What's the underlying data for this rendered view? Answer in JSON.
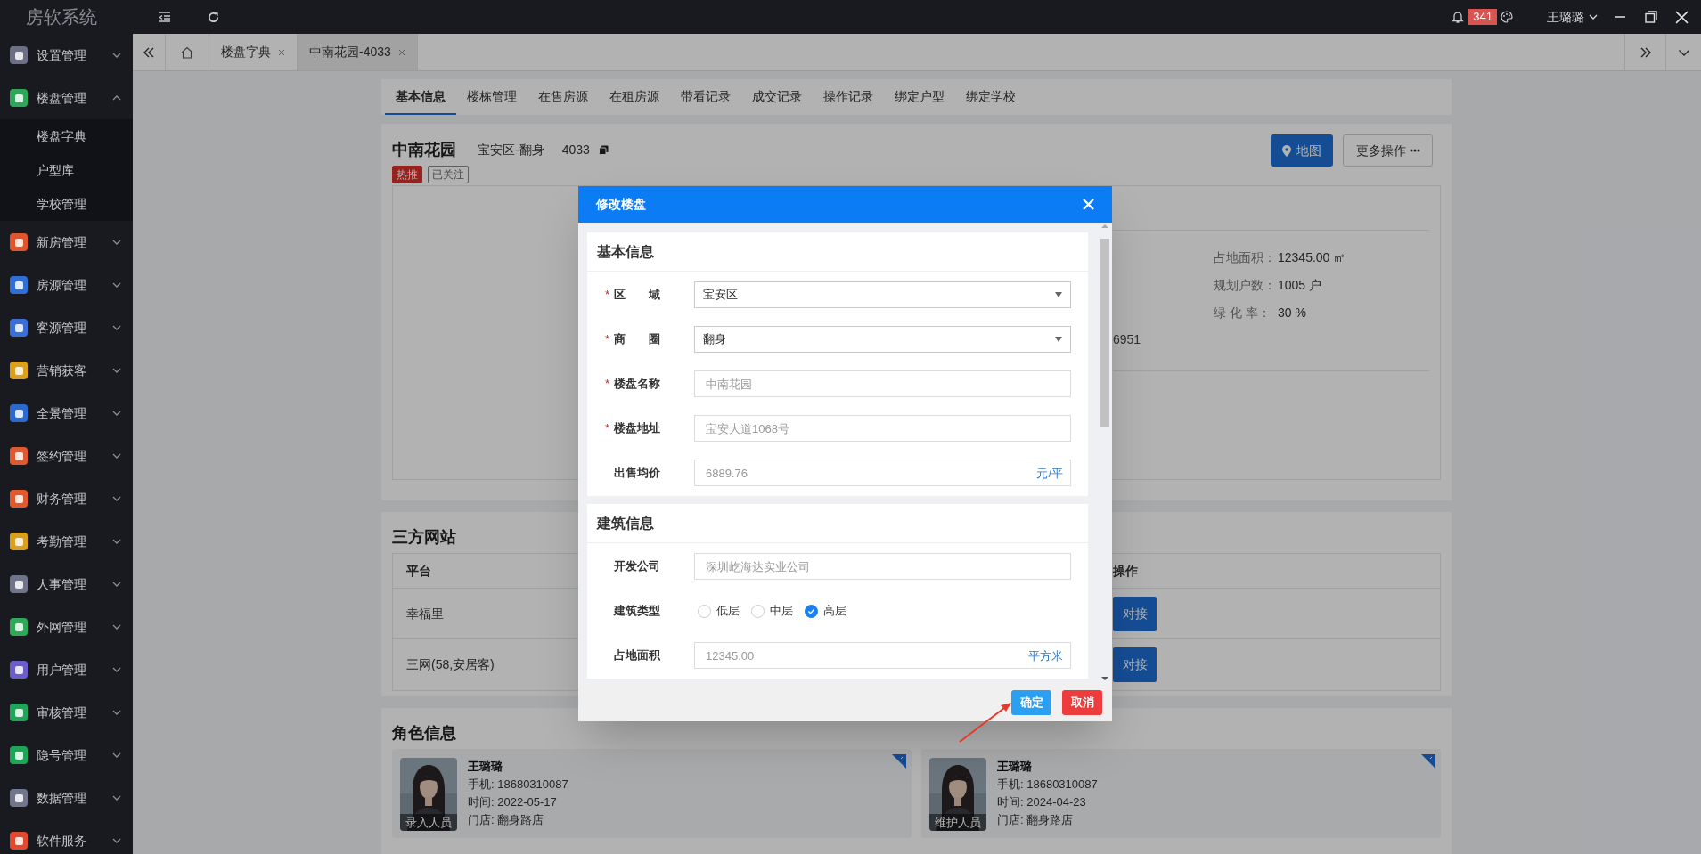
{
  "app": {
    "logo": "房软系统"
  },
  "top_bar": {
    "notifications": "341",
    "user": "王璐璐"
  },
  "sidebar": {
    "items": [
      {
        "label": "设置管理",
        "color": "#6b7084",
        "expanded": false
      },
      {
        "label": "楼盘管理",
        "color": "#2ea75b",
        "expanded": true,
        "children": [
          {
            "label": "楼盘字典"
          },
          {
            "label": "户型库"
          },
          {
            "label": "学校管理"
          }
        ]
      },
      {
        "label": "新房管理",
        "color": "#e0562c",
        "expanded": false
      },
      {
        "label": "房源管理",
        "color": "#2f6fd6",
        "expanded": false
      },
      {
        "label": "客源管理",
        "color": "#3a6fd8",
        "expanded": false
      },
      {
        "label": "营销获客",
        "color": "#dca01f",
        "expanded": false
      },
      {
        "label": "全景管理",
        "color": "#2d6ad0",
        "expanded": false
      },
      {
        "label": "签约管理",
        "color": "#df5a30",
        "expanded": false
      },
      {
        "label": "财务管理",
        "color": "#e05a2e",
        "expanded": false
      },
      {
        "label": "考勤管理",
        "color": "#d9a020",
        "expanded": false
      },
      {
        "label": "人事管理",
        "color": "#70748a",
        "expanded": false
      },
      {
        "label": "外网管理",
        "color": "#2fa85a",
        "expanded": false
      },
      {
        "label": "用户管理",
        "color": "#6a5fc8",
        "expanded": false
      },
      {
        "label": "审核管理",
        "color": "#22a45a",
        "expanded": false
      },
      {
        "label": "隐号管理",
        "color": "#1fa557",
        "expanded": false
      },
      {
        "label": "数据管理",
        "color": "#72768a",
        "expanded": false
      },
      {
        "label": "软件服务",
        "color": "#e04a2f",
        "expanded": false
      }
    ]
  },
  "page_tabs": [
    {
      "label": "楼盘字典",
      "selected": false
    },
    {
      "label": "中南花园-4033",
      "selected": true
    }
  ],
  "sub_tabs": [
    {
      "label": "基本信息",
      "selected": true
    },
    {
      "label": "楼栋管理",
      "selected": false
    },
    {
      "label": "在售房源",
      "selected": false
    },
    {
      "label": "在租房源",
      "selected": false
    },
    {
      "label": "带看记录",
      "selected": false
    },
    {
      "label": "成交记录",
      "selected": false
    },
    {
      "label": "操作记录",
      "selected": false
    },
    {
      "label": "绑定户型",
      "selected": false
    },
    {
      "label": "绑定学校",
      "selected": false
    }
  ],
  "estate": {
    "name": "中南花园",
    "district": "宝安区-翻身",
    "code": "4033",
    "tags": [
      {
        "label": "热推",
        "kind": "hot"
      },
      {
        "label": "已关注",
        "kind": "followed"
      }
    ],
    "map_button": "地图",
    "more_button": "更多操作",
    "partial_text": "6951",
    "details": [
      {
        "label": "占地面积：",
        "value": "12345.00 ㎡"
      },
      {
        "label": "规划户数：",
        "value": "1005 户"
      },
      {
        "label": "绿 化 率：",
        "value": "30 %"
      }
    ]
  },
  "third_party": {
    "title": "三方网站",
    "columns": [
      "平台",
      "操作"
    ],
    "rows": [
      {
        "platform": "幸福里",
        "action": "对接"
      },
      {
        "platform": "三网(58,安居客)",
        "action": "对接"
      }
    ]
  },
  "roles": {
    "title": "角色信息",
    "cards": [
      {
        "badge": "录入人员",
        "name": "王璐璐",
        "phone": "手机: 18680310087",
        "time": "时间: 2022-05-17",
        "store": "门店: 翻身路店"
      },
      {
        "badge": "维护人员",
        "name": "王璐璐",
        "phone": "手机: 18680310087",
        "time": "时间: 2024-04-23",
        "store": "门店: 翻身路店"
      }
    ]
  },
  "dialog": {
    "title": "修改楼盘",
    "sections": [
      {
        "title": "基本信息",
        "fields": [
          {
            "kind": "select",
            "label": "区　　域",
            "required_mark": "*",
            "value": "宝安区"
          },
          {
            "kind": "select",
            "label": "商　　圈",
            "required_mark": "*",
            "value": "翻身"
          },
          {
            "kind": "text",
            "label": "楼盘名称",
            "required_mark": "*",
            "placeholder": "中南花园"
          },
          {
            "kind": "text",
            "label": "楼盘地址",
            "required_mark": "*",
            "placeholder": "宝安大道1068号"
          },
          {
            "kind": "text",
            "label": "出售均价",
            "placeholder": "6889.76",
            "unit": "元/平"
          }
        ]
      },
      {
        "title": "建筑信息",
        "fields": [
          {
            "kind": "text",
            "label": "开发公司",
            "placeholder": "深圳屹海达实业公司"
          },
          {
            "kind": "radio",
            "label": "建筑类型",
            "options": [
              {
                "label": "低层",
                "selected": false
              },
              {
                "label": "中层",
                "selected": false
              },
              {
                "label": "高层",
                "selected": true
              }
            ]
          },
          {
            "kind": "text",
            "label": "占地面积",
            "placeholder": "12345.00",
            "unit": "平方米"
          }
        ]
      }
    ],
    "buttons": [
      {
        "label": "确定",
        "kind": "primary"
      },
      {
        "label": "取消",
        "kind": "danger"
      }
    ]
  }
}
